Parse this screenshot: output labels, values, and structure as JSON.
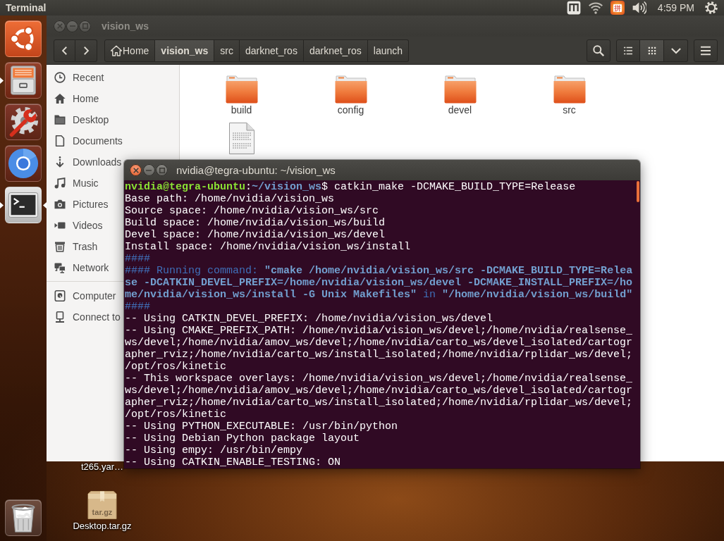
{
  "top_panel": {
    "app_title": "Terminal",
    "input_method": "拼",
    "clock": "4:59 PM"
  },
  "launcher": {
    "items": [
      {
        "kind": "dash",
        "running": false,
        "focused": false
      },
      {
        "kind": "files",
        "running": true,
        "focused": false
      },
      {
        "kind": "settings",
        "running": false,
        "focused": false
      },
      {
        "kind": "browser",
        "running": false,
        "focused": false
      },
      {
        "kind": "terminal",
        "running": true,
        "focused": true
      },
      {
        "kind": "trash",
        "running": false,
        "focused": false
      }
    ]
  },
  "desktop_icons": [
    {
      "kind": "file",
      "label": "t265.yar…"
    },
    {
      "kind": "archive",
      "label": "Desktop.tar.gz",
      "badge": "tar.gz"
    }
  ],
  "file_manager": {
    "focused": false,
    "title": "vision_ws",
    "path": [
      {
        "kind": "home",
        "label": "Home",
        "selected": false
      },
      {
        "kind": "folder",
        "label": "vision_ws",
        "selected": true
      },
      {
        "kind": "folder",
        "label": "src",
        "selected": false
      },
      {
        "kind": "folder",
        "label": "darknet_ros",
        "selected": false
      },
      {
        "kind": "folder",
        "label": "darknet_ros",
        "selected": false
      },
      {
        "kind": "folder",
        "label": "launch",
        "selected": false
      }
    ],
    "views": [
      {
        "kind": "list",
        "selected": false
      },
      {
        "kind": "grid",
        "selected": true
      }
    ],
    "sidebar": {
      "groups": [
        {
          "items": [
            {
              "kind": "recent",
              "label": "Recent",
              "selected": false
            },
            {
              "kind": "home",
              "label": "Home",
              "selected": false
            },
            {
              "kind": "desktop",
              "label": "Desktop",
              "selected": false
            },
            {
              "kind": "documents",
              "label": "Documents",
              "selected": false
            },
            {
              "kind": "downloads",
              "label": "Downloads",
              "selected": false
            },
            {
              "kind": "music",
              "label": "Music",
              "selected": false
            },
            {
              "kind": "pictures",
              "label": "Pictures",
              "selected": false
            },
            {
              "kind": "videos",
              "label": "Videos",
              "selected": false
            },
            {
              "kind": "trash",
              "label": "Trash",
              "selected": false
            },
            {
              "kind": "network",
              "label": "Network",
              "selected": false
            }
          ]
        },
        {
          "items": [
            {
              "kind": "computer",
              "label": "Computer",
              "selected": false
            },
            {
              "kind": "connect",
              "label": "Connect to",
              "selected": false
            }
          ]
        }
      ]
    },
    "files": [
      {
        "kind": "folder",
        "name": "build",
        "selected": false
      },
      {
        "kind": "folder",
        "name": "config",
        "selected": false
      },
      {
        "kind": "folder",
        "name": "devel",
        "selected": false
      },
      {
        "kind": "folder",
        "name": "src",
        "selected": false
      },
      {
        "kind": "document",
        "selected": false
      }
    ]
  },
  "terminal": {
    "focused": true,
    "title": "nvidia@tegra-ubuntu: ~/vision_ws",
    "lines": [
      {
        "segments": [
          {
            "kind": "user",
            "text": "nvidia@tegra-ubuntu"
          },
          {
            "kind": "plain",
            "text": ":"
          },
          {
            "kind": "path",
            "text": "~/vision_ws"
          },
          {
            "kind": "plain",
            "text": "$ catkin_make -DCMAKE_BUILD_TYPE=Release"
          }
        ]
      },
      {
        "segments": [
          {
            "kind": "plain",
            "text": "Base path: /home/nvidia/vision_ws"
          }
        ]
      },
      {
        "segments": [
          {
            "kind": "plain",
            "text": "Source space: /home/nvidia/vision_ws/src"
          }
        ]
      },
      {
        "segments": [
          {
            "kind": "plain",
            "text": "Build space: /home/nvidia/vision_ws/build"
          }
        ]
      },
      {
        "segments": [
          {
            "kind": "plain",
            "text": "Devel space: /home/nvidia/vision_ws/devel"
          }
        ]
      },
      {
        "segments": [
          {
            "kind": "plain",
            "text": "Install space: /home/nvidia/vision_ws/install"
          }
        ]
      },
      {
        "segments": [
          {
            "kind": "info",
            "text": "####"
          }
        ]
      },
      {
        "segments": [
          {
            "kind": "info",
            "text": "#### Running command: "
          },
          {
            "kind": "info_bold",
            "text": "\"cmake /home/nvidia/vision_ws/src -DCMAKE_BUILD_TYPE=Release -DCATKIN_DEVEL_PREFIX=/home/nvidia/vision_ws/devel -DCMAKE_INSTALL_PREFIX=/home/nvidia/vision_ws/install -G Unix Makefiles\""
          },
          {
            "kind": "info",
            "text": " in "
          },
          {
            "kind": "info_bold",
            "text": "\"/home/nvidia/vision_ws/build\""
          }
        ]
      },
      {
        "segments": [
          {
            "kind": "info",
            "text": "####"
          }
        ]
      },
      {
        "segments": [
          {
            "kind": "plain",
            "text": "-- Using CATKIN_DEVEL_PREFIX: /home/nvidia/vision_ws/devel"
          }
        ]
      },
      {
        "segments": [
          {
            "kind": "plain",
            "text": "-- Using CMAKE_PREFIX_PATH: /home/nvidia/vision_ws/devel;/home/nvidia/realsense_ws/devel;/home/nvidia/amov_ws/devel;/home/nvidia/carto_ws/devel_isolated/cartographer_rviz;/home/nvidia/carto_ws/install_isolated;/home/nvidia/rplidar_ws/devel;/opt/ros/kinetic"
          }
        ]
      },
      {
        "segments": [
          {
            "kind": "plain",
            "text": "-- This workspace overlays: /home/nvidia/vision_ws/devel;/home/nvidia/realsense_ws/devel;/home/nvidia/amov_ws/devel;/home/nvidia/carto_ws/devel_isolated/cartographer_rviz;/home/nvidia/carto_ws/install_isolated;/home/nvidia/rplidar_ws/devel;/opt/ros/kinetic"
          }
        ]
      },
      {
        "segments": [
          {
            "kind": "plain",
            "text": "-- Using PYTHON_EXECUTABLE: /usr/bin/python"
          }
        ]
      },
      {
        "segments": [
          {
            "kind": "plain",
            "text": "-- Using Debian Python package layout"
          }
        ]
      },
      {
        "segments": [
          {
            "kind": "plain",
            "text": "-- Using empy: /usr/bin/empy"
          }
        ]
      },
      {
        "segments": [
          {
            "kind": "plain",
            "text": "-- Using CATKIN_ENABLE_TESTING: ON"
          }
        ]
      }
    ]
  }
}
